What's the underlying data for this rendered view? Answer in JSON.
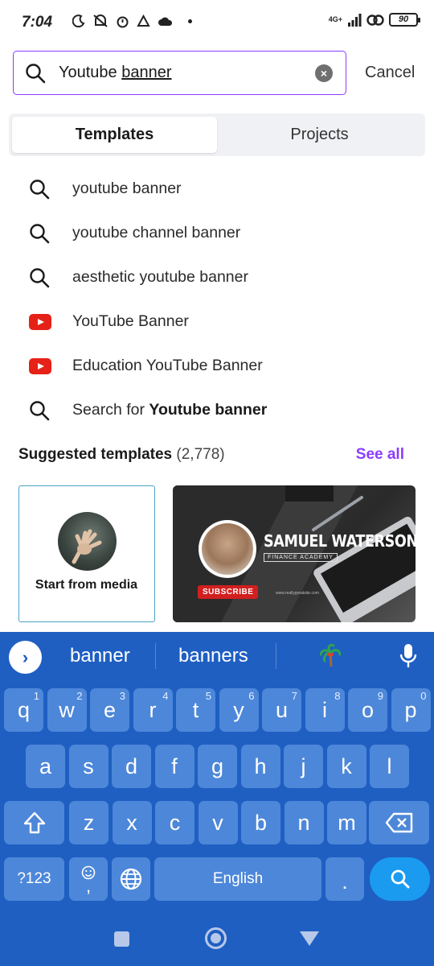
{
  "status_bar": {
    "time": "7:04",
    "network": "4G+",
    "battery": "90"
  },
  "search": {
    "value": "Youtube",
    "value_underlined": "banner",
    "cancel_label": "Cancel"
  },
  "tabs": [
    {
      "label": "Templates",
      "active": true
    },
    {
      "label": "Projects",
      "active": false
    }
  ],
  "suggestions": [
    {
      "icon": "search-icon",
      "text": "youtube banner"
    },
    {
      "icon": "search-icon",
      "text": "youtube channel banner"
    },
    {
      "icon": "search-icon",
      "text": "aesthetic youtube banner"
    },
    {
      "icon": "youtube-icon",
      "text": "YouTube Banner"
    },
    {
      "icon": "youtube-icon",
      "text": "Education YouTube Banner"
    },
    {
      "icon": "search-icon",
      "prefix": "Search for ",
      "bold": "Youtube banner"
    }
  ],
  "suggested_templates": {
    "title": "Suggested templates",
    "count": "(2,778)",
    "see_all": "See all",
    "accent_color": "#8b3dff"
  },
  "cards": {
    "media_label": "Start from media",
    "banner": {
      "name": "SAMUEL WATERSON",
      "subtitle": "FINANCE ACADEMY",
      "subscribe": "SUBSCRIBE",
      "url": "www.reallygreatsite.com"
    }
  },
  "keyboard": {
    "suggestions": [
      "banner",
      "banners"
    ],
    "row1": [
      {
        "k": "q",
        "h": "1"
      },
      {
        "k": "w",
        "h": "2"
      },
      {
        "k": "e",
        "h": "3"
      },
      {
        "k": "r",
        "h": "4"
      },
      {
        "k": "t",
        "h": "5"
      },
      {
        "k": "y",
        "h": "6"
      },
      {
        "k": "u",
        "h": "7"
      },
      {
        "k": "i",
        "h": "8"
      },
      {
        "k": "o",
        "h": "9"
      },
      {
        "k": "p",
        "h": "0"
      }
    ],
    "row2": [
      "a",
      "s",
      "d",
      "f",
      "g",
      "h",
      "j",
      "k",
      "l"
    ],
    "row3": [
      "z",
      "x",
      "c",
      "v",
      "b",
      "n",
      "m"
    ],
    "symbols_label": "?123",
    "comma_label": ",",
    "space_label": "English",
    "period_label": ".",
    "key_color": "#4d87d9",
    "bg_color": "#1f5fc2"
  }
}
